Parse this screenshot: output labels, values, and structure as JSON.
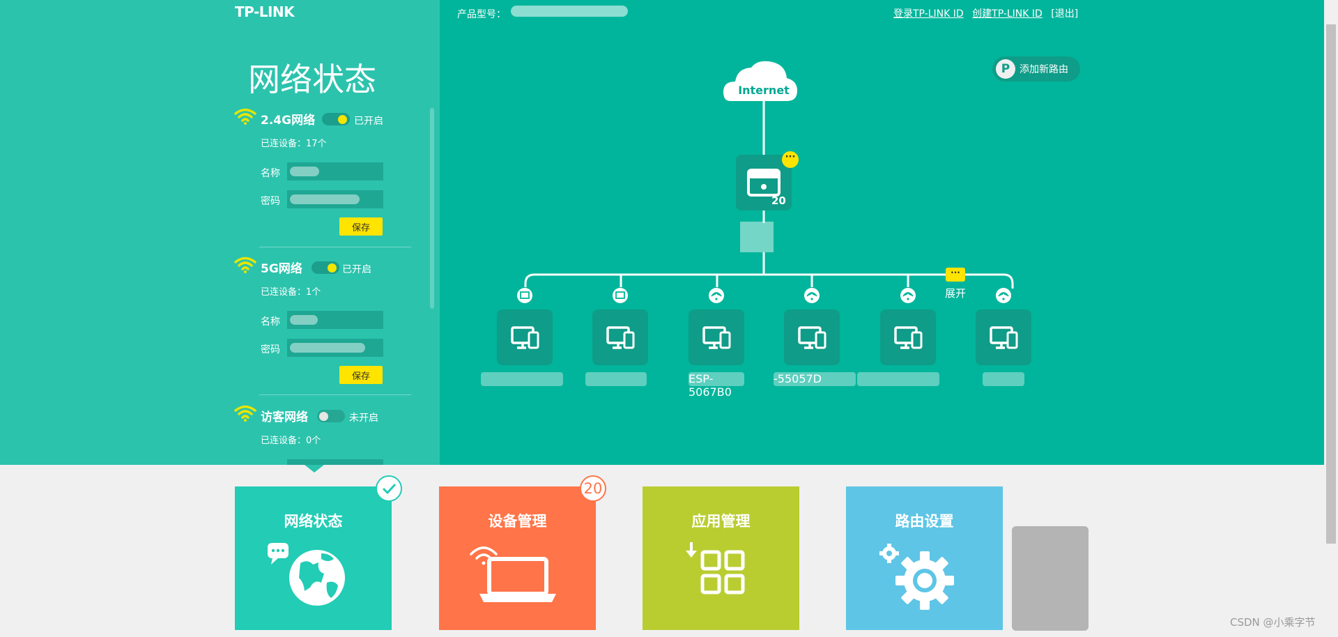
{
  "header": {
    "logo": "TP-LINK",
    "product_label": "产品型号：",
    "links": [
      "登录TP-LINK ID",
      "创建TP-LINK ID",
      "[退出]"
    ]
  },
  "panel": {
    "title": "网络状态",
    "networks": [
      {
        "title": "2.4G网络",
        "state": "已开启",
        "connected": "已连设备：17个",
        "name_label": "名称",
        "password_label": "密码",
        "save": "保存"
      },
      {
        "title": "5G网络",
        "state": "已开启",
        "connected": "已连设备：1个",
        "name_label": "名称",
        "password_label": "密码",
        "save": "保存"
      },
      {
        "title": "访客网络",
        "state": "未开启",
        "connected": "已连设备：0个"
      }
    ]
  },
  "topology": {
    "internet_label": "Internet",
    "add_router": "添加新路由",
    "router_device_count": "20",
    "router_more": "···",
    "expand_label": "展开",
    "expand_more": "···",
    "device_connections": [
      "wired",
      "wired",
      "wifi",
      "wifi",
      "wifi",
      "wifi"
    ],
    "device_names": [
      "",
      "",
      "ESP-5067B0",
      "-55057D",
      "",
      ""
    ]
  },
  "tiles": [
    {
      "title": "网络状态",
      "color": "#22ccb5",
      "badge": "check-icon"
    },
    {
      "title": "设备管理",
      "color": "#ff7448",
      "badge": "20"
    },
    {
      "title": "应用管理",
      "color": "#b9cd31"
    },
    {
      "title": "路由设置",
      "color": "#5ec5e6"
    }
  ],
  "watermark": "CSDN @小乘字节",
  "colors": {
    "accent": "#00b59b",
    "panel": "#2cc3ad",
    "highlight": "#ffe400"
  }
}
